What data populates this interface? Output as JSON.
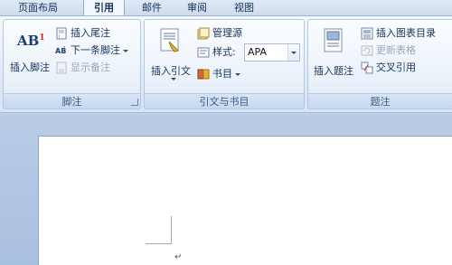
{
  "tabs": [
    {
      "label": "页面布局",
      "active": false
    },
    {
      "label": "引用",
      "active": true
    },
    {
      "label": "邮件",
      "active": false
    },
    {
      "label": "审阅",
      "active": false
    },
    {
      "label": "视图",
      "active": false
    }
  ],
  "footnotes_group": {
    "label": "脚注",
    "insert_footnote": "插入脚注",
    "insert_footnote_icon_text": "AB",
    "insert_footnote_icon_sup": "1",
    "insert_endnote": "插入尾注",
    "next_footnote": "下一条脚注",
    "show_notes": "显示备注"
  },
  "citations_group": {
    "label": "引文与书目",
    "insert_citation": "插入引文",
    "manage_sources": "管理源",
    "style_label": "样式:",
    "style_value": "APA",
    "bibliography": "书目"
  },
  "captions_group": {
    "label": "题注",
    "insert_caption": "插入题注",
    "insert_table_of_figures": "插入图表目录",
    "update_table": "更新表格",
    "cross_reference": "交叉引用"
  },
  "document": {
    "paragraph_mark": "↵"
  },
  "colors": {
    "accent": "#15315a",
    "ribbon_border": "#9db6d8",
    "workspace": "#aec4e2"
  }
}
